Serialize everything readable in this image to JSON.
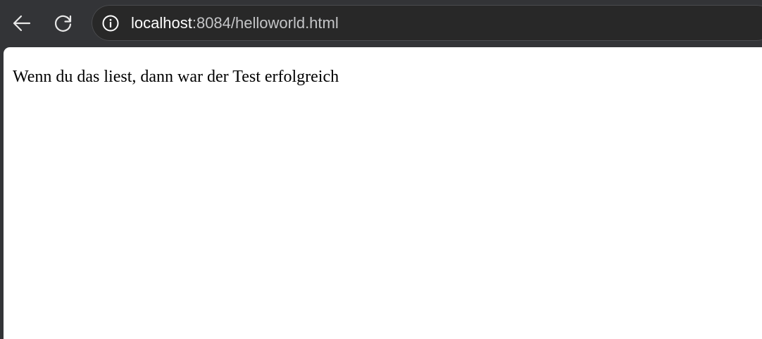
{
  "browser": {
    "toolbar": {
      "back_icon": "arrow-left-icon",
      "reload_icon": "reload-icon",
      "info_icon": "info-icon"
    },
    "address_bar": {
      "host": "localhost",
      "rest": ":8084/helloworld.html"
    }
  },
  "page": {
    "text": "Wenn du das liest, dann war der Test erfolgreich"
  },
  "colors": {
    "chrome_background": "#333437",
    "omnibox_background": "#282828",
    "page_background": "#ffffff",
    "url_host": "#ffffff",
    "url_rest": "#c4c5c7"
  }
}
